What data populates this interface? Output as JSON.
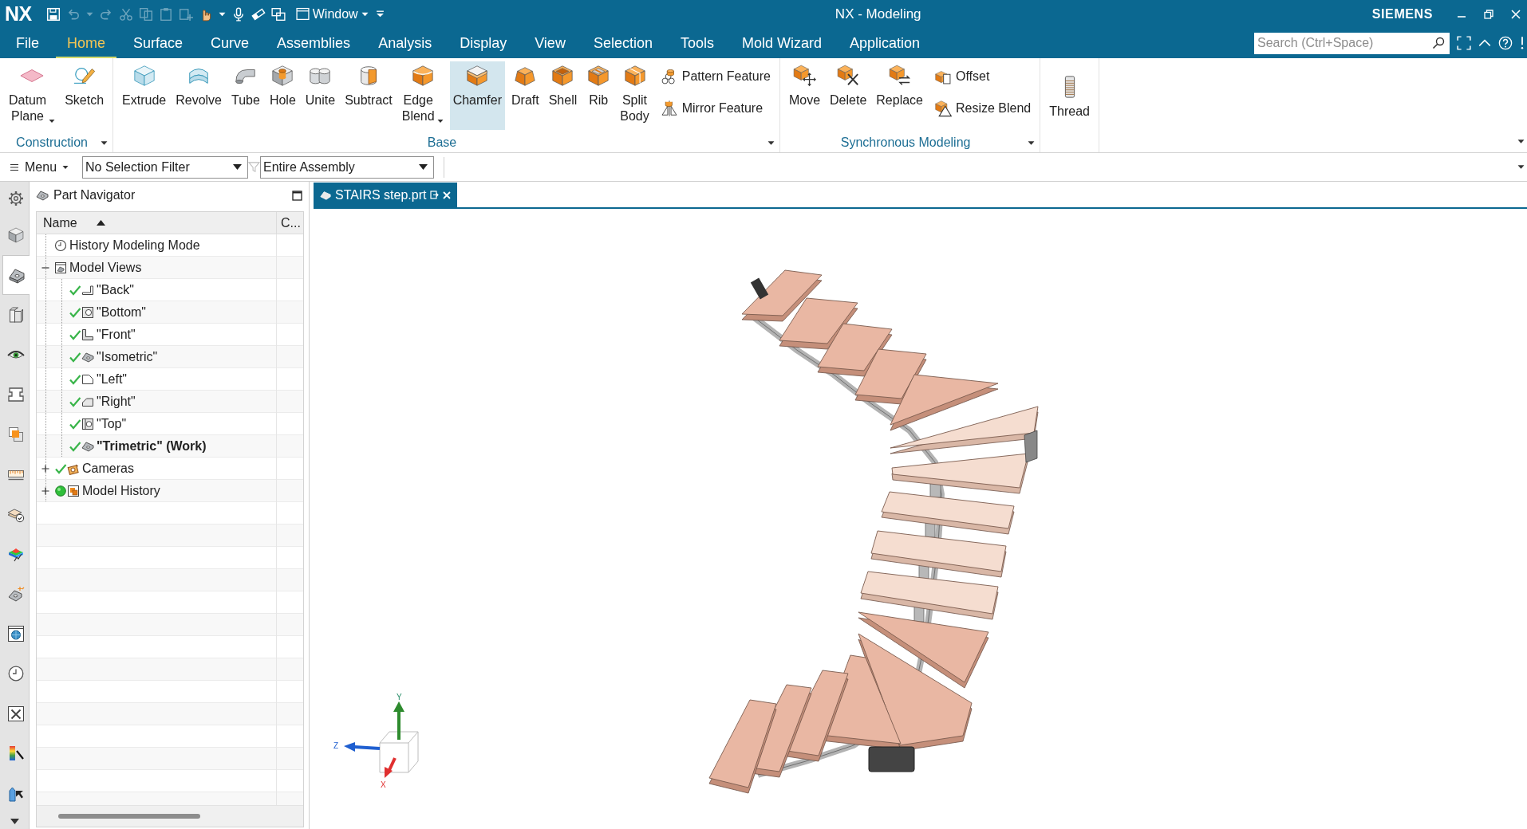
{
  "title_bar": {
    "logo": "NX",
    "quick_access": [
      {
        "kind": "save",
        "disabled": false
      },
      {
        "kind": "undo",
        "disabled": true
      },
      {
        "kind": "menu",
        "disabled": true
      },
      {
        "kind": "redo",
        "disabled": true
      },
      {
        "kind": "cut",
        "disabled": true
      },
      {
        "kind": "copy",
        "disabled": true
      },
      {
        "kind": "paste",
        "disabled": true
      },
      {
        "kind": "paste_special",
        "disabled": true
      },
      {
        "kind": "touch",
        "disabled": false
      },
      {
        "kind": "menu",
        "disabled": false
      },
      {
        "kind": "voice",
        "disabled": false
      },
      {
        "kind": "eraser",
        "disabled": false
      },
      {
        "kind": "windows",
        "disabled": false
      }
    ],
    "window_menu": "Window",
    "title": "NX - Modeling",
    "brand": "SIEMENS"
  },
  "menu_tabs": [
    {
      "label": "File",
      "selected": false
    },
    {
      "label": "Home",
      "selected": true
    },
    {
      "label": "Surface",
      "selected": false
    },
    {
      "label": "Curve",
      "selected": false
    },
    {
      "label": "Assemblies",
      "selected": false
    },
    {
      "label": "Analysis",
      "selected": false
    },
    {
      "label": "Display",
      "selected": false
    },
    {
      "label": "View",
      "selected": false
    },
    {
      "label": "Selection",
      "selected": false
    },
    {
      "label": "Tools",
      "selected": false
    },
    {
      "label": "Mold Wizard",
      "selected": false
    },
    {
      "label": "Application",
      "selected": false
    }
  ],
  "search": {
    "placeholder": "Search (Ctrl+Space)"
  },
  "ribbon": {
    "groups": [
      {
        "label": "Construction",
        "tools": [
          {
            "label": "Datum Plane",
            "dropdown": true,
            "highlighted": false
          },
          {
            "label": "Sketch",
            "dropdown": false,
            "highlighted": false
          }
        ]
      },
      {
        "label": "Base",
        "tools": [
          {
            "label": "Extrude",
            "dropdown": false,
            "highlighted": false
          },
          {
            "label": "Revolve",
            "dropdown": false,
            "highlighted": false
          },
          {
            "label": "Tube",
            "dropdown": false,
            "highlighted": false
          },
          {
            "label": "Hole",
            "dropdown": false,
            "highlighted": false
          },
          {
            "label": "Unite",
            "dropdown": false,
            "highlighted": false
          },
          {
            "label": "Subtract",
            "dropdown": false,
            "highlighted": false
          },
          {
            "label": "Edge Blend",
            "dropdown": true,
            "highlighted": false
          },
          {
            "label": "Chamfer",
            "dropdown": false,
            "highlighted": true
          },
          {
            "label": "Draft",
            "dropdown": false,
            "highlighted": false
          },
          {
            "label": "Shell",
            "dropdown": false,
            "highlighted": false
          },
          {
            "label": "Rib",
            "dropdown": false,
            "highlighted": false
          },
          {
            "label": "Split Body",
            "dropdown": false,
            "highlighted": false
          }
        ],
        "small_tools": [
          "Pattern Feature",
          "Mirror Feature"
        ]
      },
      {
        "label": "Synchronous Modeling",
        "tools": [
          {
            "label": "Move",
            "dropdown": false,
            "highlighted": false
          },
          {
            "label": "Delete",
            "dropdown": false,
            "highlighted": false
          },
          {
            "label": "Replace",
            "dropdown": false,
            "highlighted": false
          }
        ],
        "small_tools": [
          "Offset",
          "Resize Blend"
        ]
      },
      {
        "tools": [
          {
            "label": "Thread",
            "dropdown": false,
            "highlighted": false
          }
        ]
      }
    ]
  },
  "selection_bar": {
    "menu": "Menu",
    "filter": "No Selection Filter",
    "scope": "Entire Assembly"
  },
  "resource_bar": [
    {
      "selected": false
    },
    {
      "selected": false
    },
    {
      "selected": true
    },
    {
      "selected": false
    },
    {
      "selected": false
    },
    {
      "selected": false
    },
    {
      "selected": false
    },
    {
      "selected": false
    },
    {
      "selected": false
    },
    {
      "selected": false
    },
    {
      "selected": false
    },
    {
      "selected": false
    },
    {
      "selected": false
    },
    {
      "selected": false
    },
    {
      "selected": false
    },
    {
      "selected": false
    }
  ],
  "navigator": {
    "title": "Part Navigator",
    "columns": [
      "Name",
      "C..."
    ],
    "nodes": [
      {
        "label": "History Modeling Mode",
        "kind": "mode",
        "checked": false,
        "current": false
      },
      {
        "label": "Model Views",
        "kind": "views",
        "checked": false,
        "current": false,
        "expanded": true,
        "children": [
          {
            "label": "\"Back\"",
            "checked": true,
            "work": false
          },
          {
            "label": "\"Bottom\"",
            "checked": true,
            "work": false
          },
          {
            "label": "\"Front\"",
            "checked": true,
            "work": false
          },
          {
            "label": "\"Isometric\"",
            "checked": true,
            "work": false
          },
          {
            "label": "\"Left\"",
            "checked": true,
            "work": false
          },
          {
            "label": "\"Right\"",
            "checked": true,
            "work": false
          },
          {
            "label": "\"Top\"",
            "checked": true,
            "work": false
          },
          {
            "label": "\"Trimetric\" (Work)",
            "checked": true,
            "work": true
          }
        ]
      },
      {
        "label": "Cameras",
        "kind": "cameras",
        "checked": true,
        "current": false,
        "expanded": false
      },
      {
        "label": "Model History",
        "kind": "history",
        "checked": false,
        "current": true,
        "expanded": false
      }
    ]
  },
  "document_tab": {
    "label": "STAIRS step.prt",
    "selected": true
  },
  "viewport": {
    "triad": {
      "y": "Y",
      "z": "Z",
      "x": "X"
    }
  }
}
